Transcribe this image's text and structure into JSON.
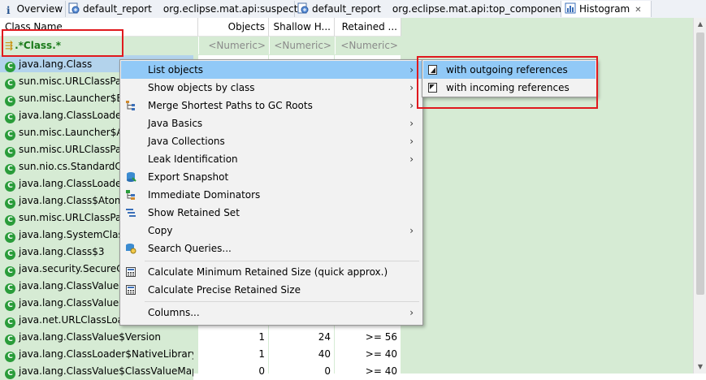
{
  "tabs": [
    {
      "icon": "info-icon",
      "label": "Overview",
      "path": "",
      "closable": false
    },
    {
      "icon": "report-icon",
      "label": "default_report",
      "path": "org.eclipse.mat.api:suspects",
      "closable": false
    },
    {
      "icon": "report-icon",
      "label": "default_report",
      "path": "org.eclipse.mat.api:top_components",
      "closable": false
    },
    {
      "icon": "histogram-icon",
      "label": "Histogram",
      "path": "",
      "closable": true,
      "close_symbol": "✕"
    }
  ],
  "columns": {
    "class_name": "Class Name",
    "objects": "Objects",
    "shallow_heap": "Shallow H...",
    "retained_heap": "Retained ..."
  },
  "filter": {
    "class_name": ".*Class.*",
    "objects": "<Numeric>",
    "shallow_heap": "<Numeric>",
    "retained_heap": "<Numeric>"
  },
  "rows": [
    {
      "name": "java.lang.Class",
      "objects": "",
      "shallow": "",
      "retained": "",
      "selected": true
    },
    {
      "name": "sun.misc.URLClassPat",
      "objects": "",
      "shallow": "",
      "retained": ""
    },
    {
      "name": "sun.misc.Launcher$Ex",
      "objects": "",
      "shallow": "",
      "retained": ""
    },
    {
      "name": "java.lang.ClassLoader",
      "objects": "",
      "shallow": "",
      "retained": ""
    },
    {
      "name": "sun.misc.Launcher$Ap",
      "objects": "",
      "shallow": "",
      "retained": ""
    },
    {
      "name": "sun.misc.URLClassPat",
      "objects": "",
      "shallow": "",
      "retained": ""
    },
    {
      "name": "sun.nio.cs.StandardCh",
      "objects": "",
      "shallow": "",
      "retained": ""
    },
    {
      "name": "java.lang.ClassLoader",
      "objects": "",
      "shallow": "",
      "retained": ""
    },
    {
      "name": "java.lang.Class$Atom",
      "objects": "",
      "shallow": "",
      "retained": ""
    },
    {
      "name": "sun.misc.URLClassPat",
      "objects": "",
      "shallow": "",
      "retained": ""
    },
    {
      "name": "java.lang.SystemClass",
      "objects": "",
      "shallow": "",
      "retained": ""
    },
    {
      "name": "java.lang.Class$3",
      "objects": "",
      "shallow": "",
      "retained": ""
    },
    {
      "name": "java.security.SecureCl",
      "objects": "",
      "shallow": "",
      "retained": ""
    },
    {
      "name": "java.lang.ClassValue",
      "objects": "",
      "shallow": "",
      "retained": ""
    },
    {
      "name": "java.lang.ClassValue$",
      "objects": "",
      "shallow": "",
      "retained": ""
    },
    {
      "name": "java.net.URLClassLoa",
      "objects": "",
      "shallow": "",
      "retained": ""
    },
    {
      "name": "java.lang.ClassValue$Version",
      "objects": "1",
      "shallow": "24",
      "retained": ">= 56"
    },
    {
      "name": "java.lang.ClassLoader$NativeLibrary",
      "objects": "1",
      "shallow": "40",
      "retained": ">= 40"
    },
    {
      "name": "java.lang.ClassValue$ClassValueMap",
      "objects": "0",
      "shallow": "0",
      "retained": ">= 40"
    }
  ],
  "context_menu": {
    "items": [
      {
        "label": "List objects",
        "icon": "",
        "submenu": true,
        "highlighted": true
      },
      {
        "label": "Show objects by class",
        "icon": "",
        "submenu": true
      },
      {
        "label": "Merge Shortest Paths to GC Roots",
        "icon": "merge-paths-icon",
        "submenu": true
      },
      {
        "label": "Java Basics",
        "icon": "",
        "submenu": true
      },
      {
        "label": "Java Collections",
        "icon": "",
        "submenu": true
      },
      {
        "label": "Leak Identification",
        "icon": "",
        "submenu": true
      },
      {
        "label": "Export Snapshot",
        "icon": "export-snapshot-icon",
        "submenu": false
      },
      {
        "label": "Immediate Dominators",
        "icon": "immediate-dominators-icon",
        "submenu": false
      },
      {
        "label": "Show Retained Set",
        "icon": "retained-set-icon",
        "submenu": false
      },
      {
        "label": "Copy",
        "icon": "",
        "submenu": true
      },
      {
        "label": "Search Queries...",
        "icon": "search-queries-icon",
        "submenu": false
      },
      {
        "label": "Calculate Minimum Retained Size (quick approx.)",
        "icon": "calculator-icon",
        "submenu": false
      },
      {
        "label": "Calculate Precise Retained Size",
        "icon": "calculator-icon",
        "submenu": false
      },
      {
        "label": "Columns...",
        "icon": "",
        "submenu": true
      }
    ],
    "submenu_symbol": "›"
  },
  "submenu": {
    "items": [
      {
        "label": "with outgoing references",
        "icon": "outgoing-references-icon",
        "highlighted": true
      },
      {
        "label": "with incoming references",
        "icon": "incoming-references-icon"
      }
    ]
  },
  "class_icon_letter": "C",
  "colors": {
    "grid_background": "#d6ebd4",
    "selection": "#b3d3ec",
    "menu_highlight": "#91c9f7",
    "annotation_red": "#e0191e",
    "class_icon": "#2a9c3a"
  }
}
